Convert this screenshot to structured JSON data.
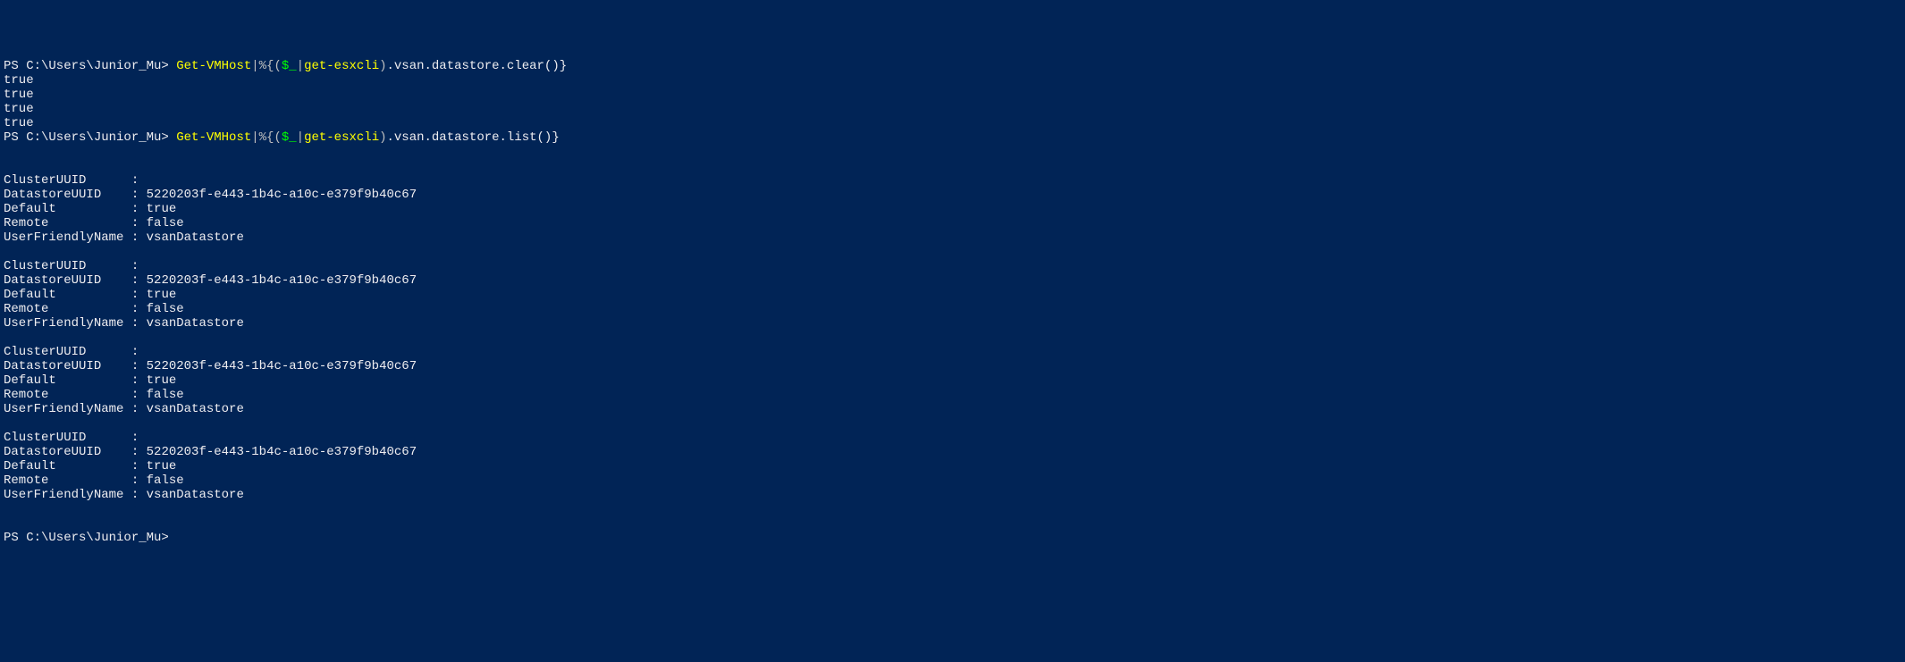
{
  "prompt1": {
    "prefix": "PS C:\\Users\\Junior_Mu> ",
    "cmdlet1": "Get-VMHost",
    "pipe1": "|%{(",
    "dollar": "$_",
    "pipe2": "|",
    "cmdlet2": "get-esxcli",
    "brace": ")",
    "method": ".vsan.datastore.clear()}"
  },
  "results1": [
    "true",
    "true",
    "true",
    "true"
  ],
  "prompt2": {
    "prefix": "PS C:\\Users\\Junior_Mu> ",
    "cmdlet1": "Get-VMHost",
    "pipe1": "|%{(",
    "dollar": "$_",
    "pipe2": "|",
    "cmdlet2": "get-esxcli",
    "brace": ")",
    "method": ".vsan.datastore.list()}"
  },
  "blocks": [
    {
      "ClusterUUID": "",
      "DatastoreUUID": "5220203f-e443-1b4c-a10c-e379f9b40c67",
      "Default": "true",
      "Remote": "false",
      "UserFriendlyName": "vsanDatastore"
    },
    {
      "ClusterUUID": "",
      "DatastoreUUID": "5220203f-e443-1b4c-a10c-e379f9b40c67",
      "Default": "true",
      "Remote": "false",
      "UserFriendlyName": "vsanDatastore"
    },
    {
      "ClusterUUID": "",
      "DatastoreUUID": "5220203f-e443-1b4c-a10c-e379f9b40c67",
      "Default": "true",
      "Remote": "false",
      "UserFriendlyName": "vsanDatastore"
    },
    {
      "ClusterUUID": "",
      "DatastoreUUID": "5220203f-e443-1b4c-a10c-e379f9b40c67",
      "Default": "true",
      "Remote": "false",
      "UserFriendlyName": "vsanDatastore"
    }
  ],
  "prompt3": {
    "prefix": "PS C:\\Users\\Junior_Mu> "
  },
  "propLabels": {
    "ClusterUUID": "ClusterUUID      :",
    "DatastoreUUID": "DatastoreUUID    :",
    "Default": "Default          :",
    "Remote": "Remote           :",
    "UserFriendlyName": "UserFriendlyName :"
  }
}
